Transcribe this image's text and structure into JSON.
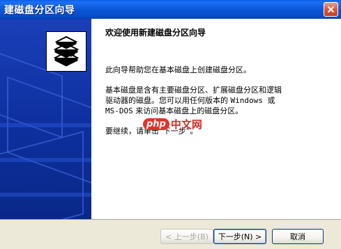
{
  "window": {
    "title": "建磁盘分区向导",
    "close_icon": "close-icon"
  },
  "banner": {
    "background": "#0d2f9e",
    "logo_icon": "disk-stack-icon"
  },
  "content": {
    "heading": "欢迎使用新建磁盘分区向导",
    "intro": "此向导帮助您在基本磁盘上创建磁盘分区。",
    "basic_line1": "基本磁盘是含有主要磁盘分区、扩展磁盘分区和逻辑",
    "basic_line2_a": "驱动器的磁盘。您可以用任何版本的 ",
    "basic_line2_b": "Windows 或",
    "basic_line3_a": "MS-DOS",
    "basic_line3_b": " 来访问基本磁盘上的磁盘分区。",
    "continue": "要继续，请单击“下一步”。"
  },
  "watermark": {
    "badge": "php",
    "text": "中文网"
  },
  "buttons": {
    "back": "< 上一步(B)",
    "next": "下一步(N) >",
    "cancel": "取消"
  }
}
